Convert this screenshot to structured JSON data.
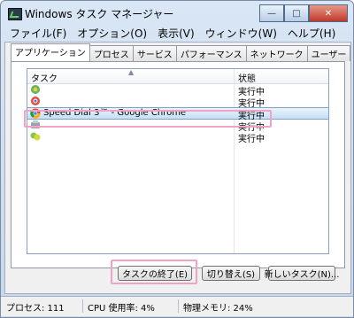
{
  "window": {
    "title": "Windows タスク マネージャー",
    "buttons": {
      "minimize": "—",
      "maximize": "□",
      "close": "✕"
    }
  },
  "menu": [
    "ファイル(F)",
    "オプション(O)",
    "表示(V)",
    "ウィンドウ(W)",
    "ヘルプ(H)"
  ],
  "tabs": [
    "アプリケーション",
    "プロセス",
    "サービス",
    "パフォーマンス",
    "ネットワーク",
    "ユーザー"
  ],
  "active_tab": "アプリケーション",
  "list": {
    "headers": {
      "task": "タスク",
      "status": "状態"
    },
    "rows": [
      {
        "icon": "app-icon-1",
        "name": "",
        "status": "実行中"
      },
      {
        "icon": "app-icon-2",
        "name": "",
        "status": "実行中"
      },
      {
        "icon": "chrome-icon",
        "name": "Speed Dial 3™ - Google Chrome",
        "status": "実行中",
        "selected": true
      },
      {
        "icon": "app-icon-3",
        "name": "",
        "status": "実行中"
      },
      {
        "icon": "app-icon-4",
        "name": "",
        "status": "実行中"
      }
    ]
  },
  "buttons": {
    "end_task": "タスクの終了(E)",
    "switch_to": "切り替え(S)",
    "new_task": "新しいタスク(N)..."
  },
  "statusbar": {
    "processes": "プロセス: 111",
    "cpu": "CPU 使用率: 4%",
    "memory": "物理メモリ: 24%"
  },
  "colors": {
    "highlight": "#f2a3c3",
    "selection": "#c6def6"
  }
}
